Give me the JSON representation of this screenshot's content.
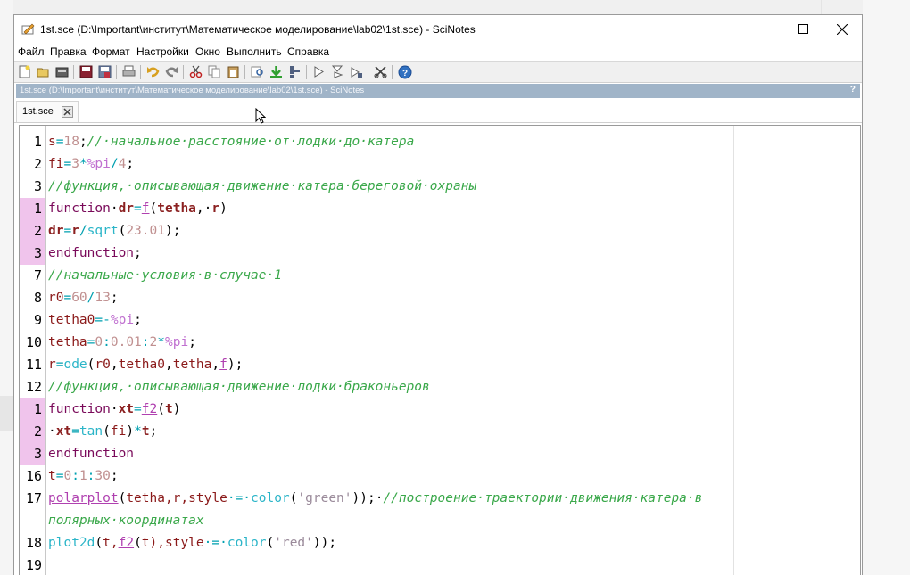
{
  "window": {
    "title": "1st.sce (D:\\Important\\институт\\Математическое моделирование\\lab02\\1st.sce) - SciNotes"
  },
  "menu": [
    "Файл",
    "Правка",
    "Формат",
    "Настройки",
    "Окно",
    "Выполнить",
    "Справка"
  ],
  "toolbar_icons": [
    "new-file-icon",
    "open-icon",
    "open-folder-icon",
    "save-icon",
    "save-as-icon",
    "print-icon",
    "undo-icon",
    "redo-icon",
    "cut-icon",
    "copy-icon",
    "paste-icon",
    "find-replace-icon",
    "load-into-scilab-icon",
    "save-and-execute-icon",
    "execute-icon",
    "execute-until-cursor-icon",
    "execute-selection-icon",
    "scissors-tools-icon",
    "help-icon"
  ],
  "pathbar": {
    "text": "1st.sce (D:\\Important\\институт\\Математическое моделирование\\lab02\\1st.sce) - SciNotes",
    "help": "?"
  },
  "tab": {
    "label": "1st.sce"
  },
  "colors": {
    "pathbar": "#a0b4c8",
    "gutter_function": "#f0c4ec",
    "comment": "#3aa84a"
  },
  "code_lines": [
    {
      "n": "1",
      "fn": false
    },
    {
      "n": "2",
      "fn": false
    },
    {
      "n": "3",
      "fn": false
    },
    {
      "n": "1",
      "fn": true
    },
    {
      "n": "2",
      "fn": true
    },
    {
      "n": "3",
      "fn": true
    },
    {
      "n": "7",
      "fn": false
    },
    {
      "n": "8",
      "fn": false
    },
    {
      "n": "9",
      "fn": false
    },
    {
      "n": "10",
      "fn": false
    },
    {
      "n": "11",
      "fn": false
    },
    {
      "n": "12",
      "fn": false
    },
    {
      "n": "1",
      "fn": true
    },
    {
      "n": "2",
      "fn": true
    },
    {
      "n": "3",
      "fn": true
    },
    {
      "n": "16",
      "fn": false
    },
    {
      "n": "17",
      "fn": false
    },
    {
      "n": "",
      "fn": false
    },
    {
      "n": "18",
      "fn": false
    },
    {
      "n": "19",
      "fn": false
    }
  ],
  "code": {
    "l1": [
      "s",
      "=",
      "18",
      ";",
      "//·начальное·расстояние·от·лодки·до·катера"
    ],
    "l2": [
      "fi",
      "=",
      "3",
      "*",
      "%pi",
      "/",
      "4",
      ";"
    ],
    "l3": [
      "//функция,·описывающая·движение·катера·береговой·охраны"
    ],
    "l4": [
      "function",
      "·",
      "dr",
      "=",
      "f",
      "(",
      "tetha",
      ",·",
      "r",
      ")"
    ],
    "l5": [
      "dr",
      "=",
      "r",
      "/",
      "sqrt",
      "(",
      "23.01",
      ");"
    ],
    "l6": [
      "endfunction",
      ";"
    ],
    "l7": [
      "//начальные·условия·в·случае·1"
    ],
    "l8": [
      "r0",
      "=",
      "60",
      "/",
      "13",
      ";"
    ],
    "l9": [
      "tetha0",
      "=-",
      "%pi",
      ";"
    ],
    "l10": [
      "tetha",
      "=",
      "0",
      ":",
      "0.01",
      ":",
      "2",
      "*",
      "%pi",
      ";"
    ],
    "l11": [
      "r",
      "=",
      "ode",
      "(",
      "r0",
      ",",
      "tetha0",
      ",",
      "tetha",
      ",",
      "f",
      ");"
    ],
    "l12": [
      "//функция,·описывающая·движение·лодки·браконьеров"
    ],
    "l13": [
      "function",
      "·",
      "xt",
      "=",
      "f2",
      "(",
      "t",
      ")"
    ],
    "l14": [
      "·",
      "xt",
      "=",
      "tan",
      "(",
      "fi",
      ")",
      "*",
      "t",
      ";"
    ],
    "l15": [
      "endfunction"
    ],
    "l16": [
      "t",
      "=",
      "0",
      ":",
      "1",
      ":",
      "30",
      ";"
    ],
    "l17": [
      "polarplot",
      "(",
      "tetha,r,style",
      "·=·",
      "color",
      "(",
      "'green'",
      "));",
      "·",
      "//построение·траектории·движения·катера·в"
    ],
    "l17b": [
      "полярных·координатах"
    ],
    "l18": [
      "plot2d",
      "(",
      "t,",
      "f2",
      "(",
      "t",
      "),style",
      "·=·",
      "color",
      "(",
      "'red'",
      "));"
    ],
    "l19": []
  }
}
